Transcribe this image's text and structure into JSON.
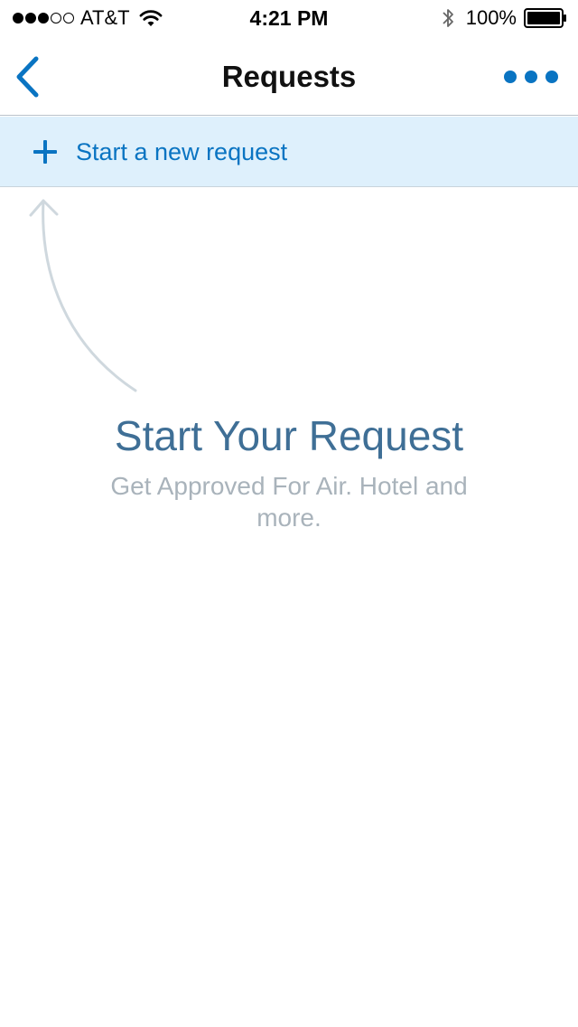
{
  "status_bar": {
    "carrier": "AT&T",
    "signal_strength": 3,
    "signal_max": 5,
    "time": "4:21 PM",
    "battery_percent": "100%",
    "icons": [
      "signal-dots-icon",
      "wifi-icon",
      "bluetooth-icon",
      "battery-icon"
    ]
  },
  "nav": {
    "title": "Requests",
    "back_icon": "chevron-left-icon",
    "more_icon": "more-horizontal-icon"
  },
  "new_request": {
    "label": "Start a new request",
    "icon": "plus-icon"
  },
  "empty_state": {
    "title": "Start Your Request",
    "subtitle": "Get Approved For Air. Hotel and more.",
    "hint_icon": "curved-arrow-up-icon"
  },
  "colors": {
    "accent": "#0a74c2",
    "new_request_bg": "#def0fc",
    "empty_title": "#3f6f96",
    "empty_subtitle": "#a9b3bb",
    "hint_arrow": "#cfd8de"
  }
}
